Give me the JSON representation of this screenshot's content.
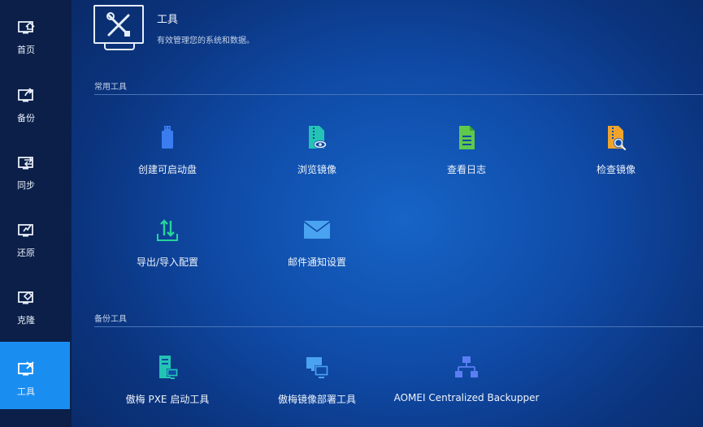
{
  "sidebar": {
    "items": [
      {
        "label": "首页",
        "icon": "home-icon"
      },
      {
        "label": "备份",
        "icon": "backup-icon"
      },
      {
        "label": "同步",
        "icon": "sync-icon"
      },
      {
        "label": "还原",
        "icon": "restore-icon"
      },
      {
        "label": "克隆",
        "icon": "clone-icon"
      },
      {
        "label": "工具",
        "icon": "tools-icon",
        "active": true
      }
    ]
  },
  "header": {
    "title": "工具",
    "subtitle": "有效管理您的系统和数据。",
    "icon": "tools-monitor-icon"
  },
  "sections": {
    "common": {
      "title": "常用工具",
      "tools": [
        {
          "label": "创建可启动盘",
          "icon": "usb-drive-icon",
          "color": "#3b7df0"
        },
        {
          "label": "浏览镜像",
          "icon": "explore-image-icon",
          "color": "#23c4b4"
        },
        {
          "label": "查看日志",
          "icon": "log-icon",
          "color": "#5ec94a"
        },
        {
          "label": "检查镜像",
          "icon": "check-image-icon",
          "color": "#f0a42c"
        },
        {
          "label": "导出/导入配置",
          "icon": "export-import-icon",
          "color": "#27d49b"
        },
        {
          "label": "邮件通知设置",
          "icon": "mail-icon",
          "color": "#4aa3f0"
        }
      ]
    },
    "backup": {
      "title": "备份工具",
      "tools": [
        {
          "label": "傲梅 PXE 启动工具",
          "icon": "pxe-boot-icon",
          "color": "#23c4b4"
        },
        {
          "label": "傲梅镜像部署工具",
          "icon": "image-deploy-icon",
          "color": "#4aa3f0"
        },
        {
          "label": "AOMEI Centralized Backupper",
          "icon": "network-icon",
          "color": "#5b7ef2"
        }
      ]
    }
  }
}
